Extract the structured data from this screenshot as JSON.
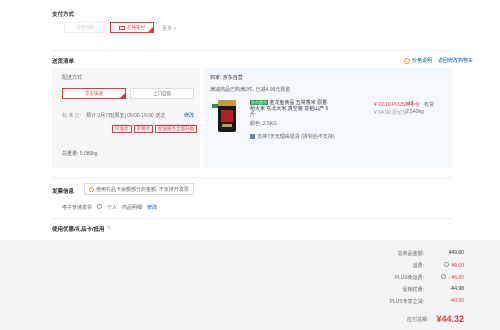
{
  "payment": {
    "title": "支付方式",
    "options": [
      "货到付款",
      "在线支付",
      "更多 >"
    ],
    "selected_index": 1
  },
  "delivery_list": {
    "title": "送货清单",
    "price_note": "价格说明",
    "back_to_cart": "返回修改购物车",
    "shipping_method_label": "配送方式",
    "shipping_options": [
      "京东快递",
      "上门自提"
    ],
    "standard_delivery": "标 准 达:",
    "delivery_time": "预计 3月7日[周五] 09:00-15:00 送达",
    "modify": "修改",
    "service_tags": [
      "京准达",
      "京尊达",
      "配送服务全面升级"
    ],
    "total_weight": "总重量: 5.080kg",
    "merchant_label": "商家: 京东自营",
    "promo_text": "满减商品已购满2件, 已减4.98元现金",
    "product": {
      "badge": "京东超市",
      "name": "金龙鱼食品 五常香米 原香稻大米 东北大米 真空装 龙稻山产 5斤",
      "color": "颜色: 2.5KG",
      "service": "支持7天无理由退货 (拆封后不支持)",
      "plus_price": "¥ 22.16 PLUS到手价",
      "orig_price": "¥ 24.90 原价价",
      "qty": "x2",
      "stock": "有货",
      "weight": "2.540kg"
    }
  },
  "invoice": {
    "title": "发票信息",
    "tip": "使用礼品卡余额部分的金额, 不支持开发票",
    "type": "电子普通发票",
    "person": "个人",
    "detail": "商品明细",
    "modify": "修改"
  },
  "coupons": {
    "title": "使用优惠/礼品卡/抵用",
    "chevron": "v"
  },
  "summary": {
    "rows": [
      {
        "label": "总商品金额:",
        "value": "¥49.80",
        "info": false
      },
      {
        "label": "运费:",
        "value": "¥6.00",
        "info": true
      },
      {
        "label": "PLUS免运费:",
        "value": "- ¥6.00",
        "info": true
      },
      {
        "label": "促销优惠:",
        "value": "-¥4.98",
        "info": false
      },
      {
        "label": "PLUS专享立减:",
        "value": "-¥0.50",
        "info": false
      }
    ],
    "total_label": "应付总额:",
    "total_value": "¥44.32"
  },
  "colors": {
    "accent": "#e4393c",
    "link": "#005ea7",
    "panel_bg": "#f3f9fd",
    "summary_bg": "#f4f4f4"
  }
}
